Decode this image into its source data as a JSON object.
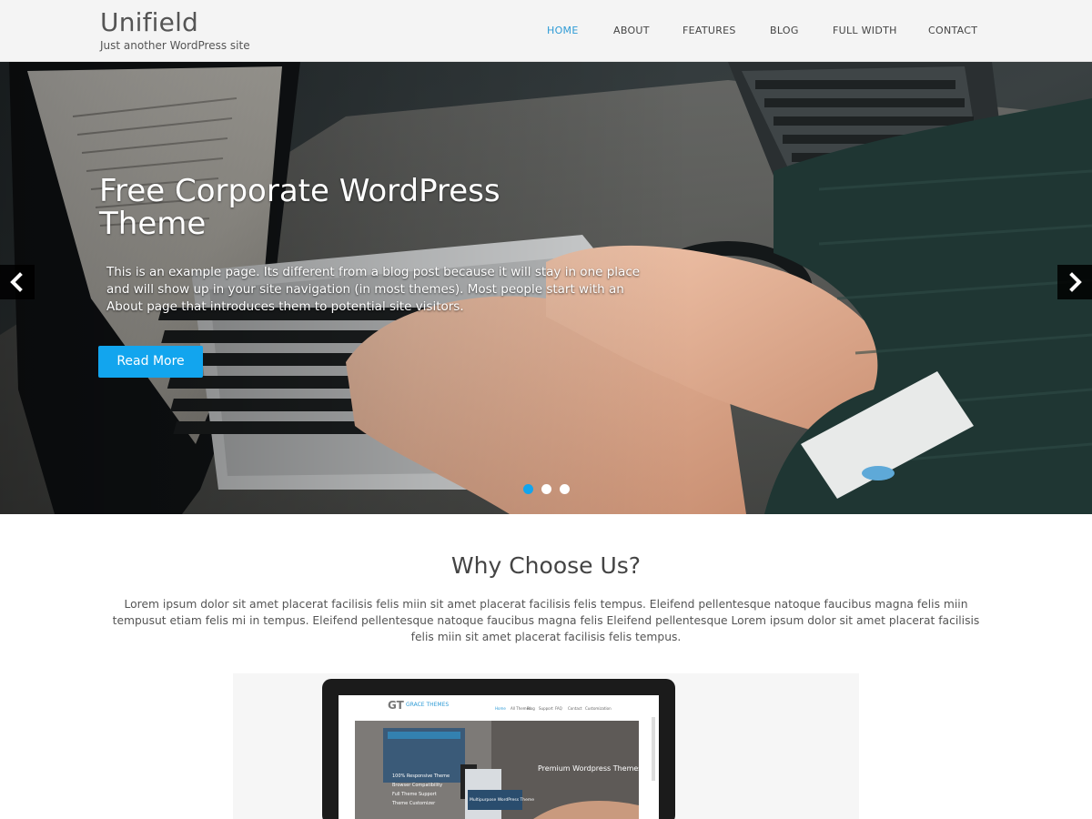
{
  "header": {
    "site_title": "Unifield",
    "tagline": "Just another WordPress site"
  },
  "nav": {
    "items": [
      {
        "label": "HOME",
        "active": true
      },
      {
        "label": "ABOUT",
        "active": false
      },
      {
        "label": "FEATURES",
        "active": false
      },
      {
        "label": "BLOG",
        "active": false
      },
      {
        "label": "FULL WIDTH",
        "active": false
      },
      {
        "label": "CONTACT",
        "active": false
      }
    ]
  },
  "hero": {
    "title": "Free Corporate WordPress Theme",
    "text": "This is an example page. Its different from a blog post because it will stay in one place and will show up in your site navigation (in most themes). Most people start with an About page that introduces them to potential site visitors.",
    "button_label": "Read More",
    "prev_icon": "chevron-left-icon",
    "next_icon": "chevron-right-icon",
    "slides_count": 3,
    "active_slide": 1
  },
  "why": {
    "title": "Why Choose Us?",
    "text": "Lorem ipsum dolor sit amet placerat facilisis felis miin sit amet placerat facilisis felis tempus. Eleifend pellentesque natoque faucibus magna felis miin tempusut etiam felis mi in tempus. Eleifend pellentesque natoque faucibus magna felis Eleifend pellentesque Lorem ipsum dolor sit amet placerat facilisis felis miin sit amet placerat facilisis felis tempus."
  },
  "showcase": {
    "brand": "GRACE THEMES",
    "brand_mark": "GT",
    "slide_heading": "Premium Wordpress Themes",
    "menu": [
      "Home",
      "All Themes",
      "Blog",
      "Support",
      "FAQ",
      "Contact",
      "Customization"
    ],
    "features": [
      "100% Responsive Theme",
      "Browser Compatibility",
      "Full Theme Support",
      "Theme Customizer"
    ],
    "badge": "Multipurpose WordPress Theme"
  },
  "colors": {
    "accent": "#12a5ee",
    "nav_active": "#2e9bd6"
  }
}
